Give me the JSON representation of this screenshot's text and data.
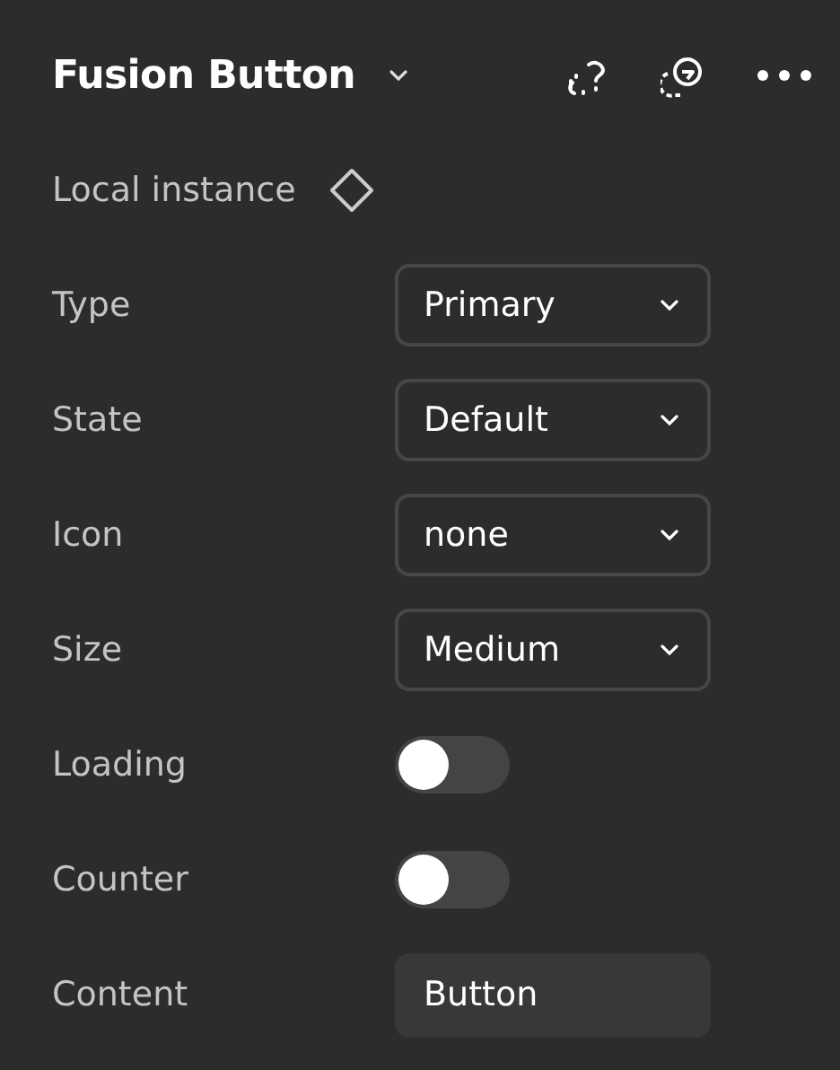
{
  "header": {
    "title": "Fusion Button"
  },
  "instance": {
    "label": "Local instance"
  },
  "properties": [
    {
      "kind": "select",
      "label": "Type",
      "value": "Primary"
    },
    {
      "kind": "select",
      "label": "State",
      "value": "Default"
    },
    {
      "kind": "select",
      "label": "Icon",
      "value": "none"
    },
    {
      "kind": "select",
      "label": "Size",
      "value": "Medium"
    },
    {
      "kind": "toggle",
      "label": "Loading",
      "on": false
    },
    {
      "kind": "toggle",
      "label": "Counter",
      "on": false
    },
    {
      "kind": "text",
      "label": "Content",
      "value": "Button"
    }
  ]
}
